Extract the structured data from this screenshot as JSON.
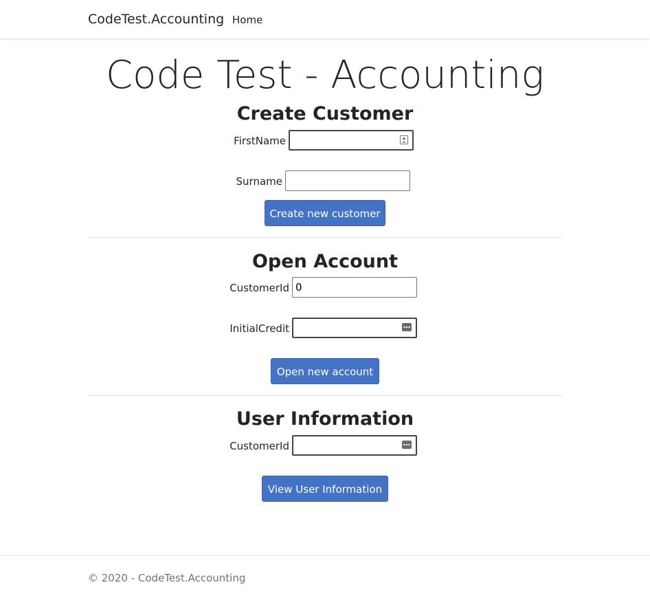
{
  "navbar": {
    "brand": "CodeTest.Accounting",
    "home_link": "Home"
  },
  "page_title": "Code Test - Accounting",
  "create_customer": {
    "title": "Create Customer",
    "firstname_label": "FirstName",
    "firstname_value": "",
    "surname_label": "Surname",
    "surname_value": "",
    "button_label": "Create new customer"
  },
  "open_account": {
    "title": "Open Account",
    "customerid_label": "CustomerId",
    "customerid_value": "0",
    "initialcredit_label": "InitialCredit",
    "initialcredit_value": "",
    "button_label": "Open new account"
  },
  "user_information": {
    "title": "User Information",
    "customerid_label": "CustomerId",
    "customerid_value": "",
    "button_label": "View User Information"
  },
  "footer": {
    "text": "© 2020 - CodeTest.Accounting"
  },
  "colors": {
    "primary_button": "#4472c4",
    "footer_text": "#6c757d"
  },
  "icons": {
    "firstname_field": "contact-card-icon",
    "initialcredit_field": "more-dots-icon",
    "user_customerid_field": "more-dots-icon"
  }
}
